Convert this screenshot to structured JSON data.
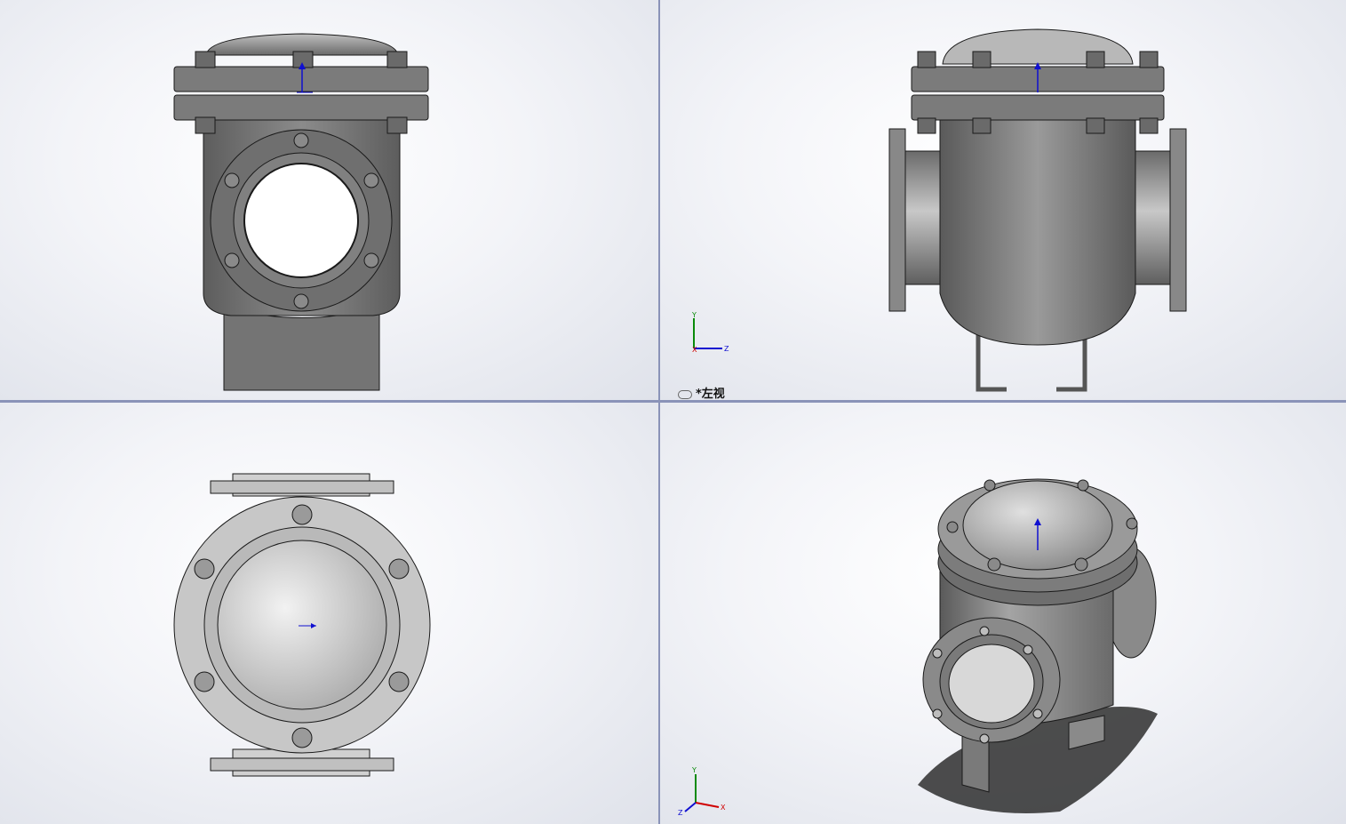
{
  "viewports": {
    "top_left": {
      "name": "front"
    },
    "top_right": {
      "name": "left",
      "label": "*左视"
    },
    "bottom_left": {
      "name": "top"
    },
    "bottom_right": {
      "name": "isometric"
    }
  },
  "triad": {
    "x": "X",
    "y": "Y",
    "z": "Z"
  },
  "colors": {
    "background": "#f3f4f8",
    "metal": "#7a7a7a",
    "metal_light": "#c9c9c9",
    "outline": "#1a1a1a",
    "axis_x": "#d00000",
    "axis_y": "#0a8a0a",
    "axis_z": "#1010d0",
    "splitter": "#8a93b8"
  }
}
